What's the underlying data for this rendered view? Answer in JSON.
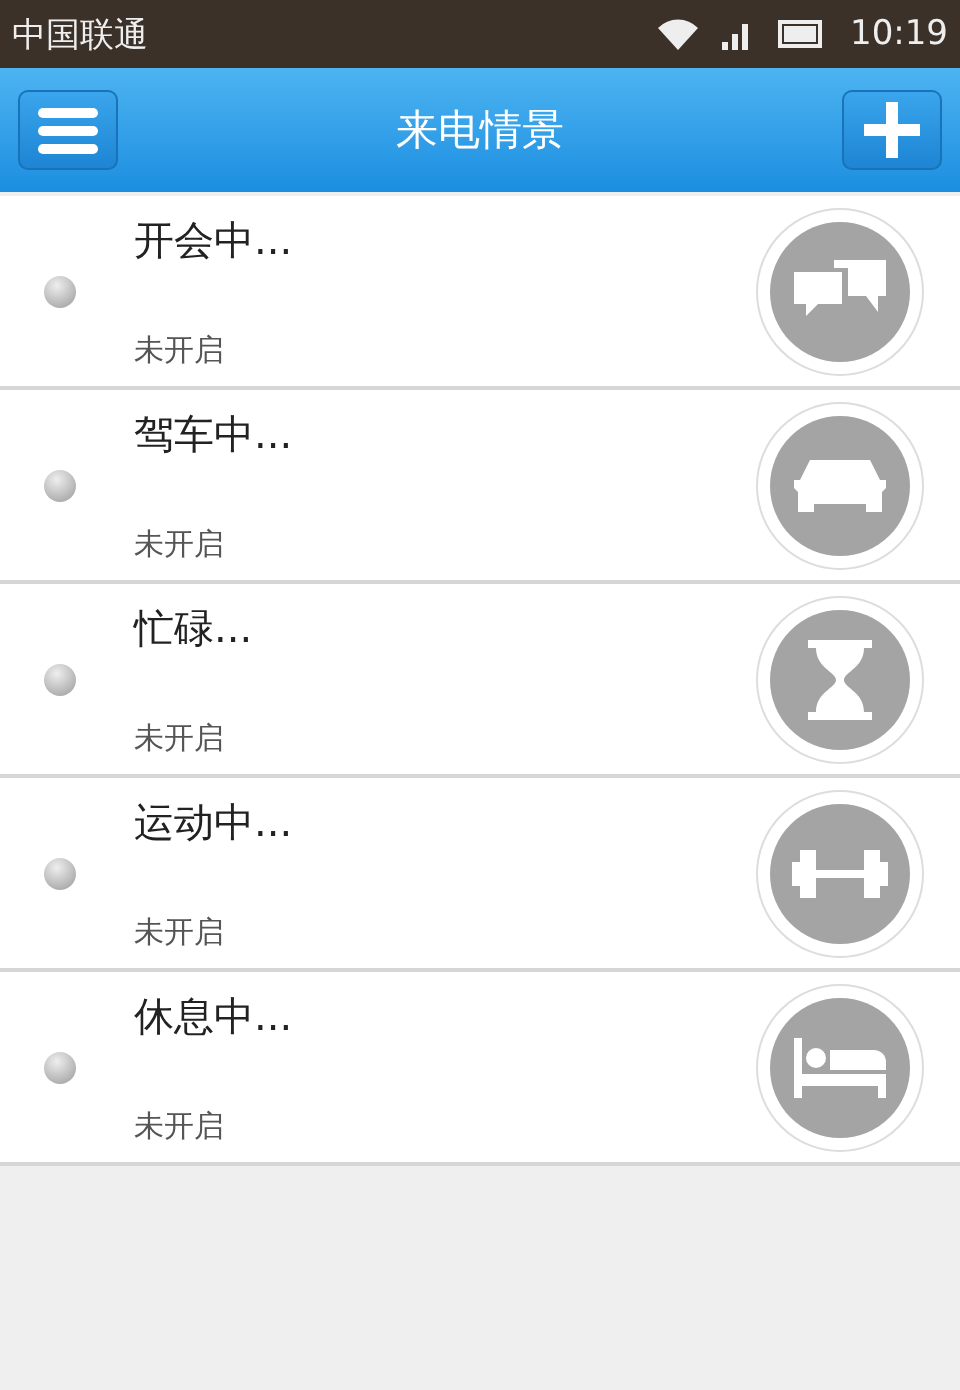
{
  "status_bar": {
    "carrier": "中国联通",
    "time": "10:19"
  },
  "header": {
    "title": "来电情景"
  },
  "scenes": [
    {
      "title": "开会中...",
      "status": "未开启",
      "on": false,
      "kind": "chat"
    },
    {
      "title": "驾车中...",
      "status": "未开启",
      "on": false,
      "kind": "car"
    },
    {
      "title": "忙碌...",
      "status": "未开启",
      "on": false,
      "kind": "hourglass"
    },
    {
      "title": "运动中...",
      "status": "未开启",
      "on": false,
      "kind": "dumbbell"
    },
    {
      "title": "休息中...",
      "status": "未开启",
      "on": false,
      "kind": "bed"
    }
  ]
}
